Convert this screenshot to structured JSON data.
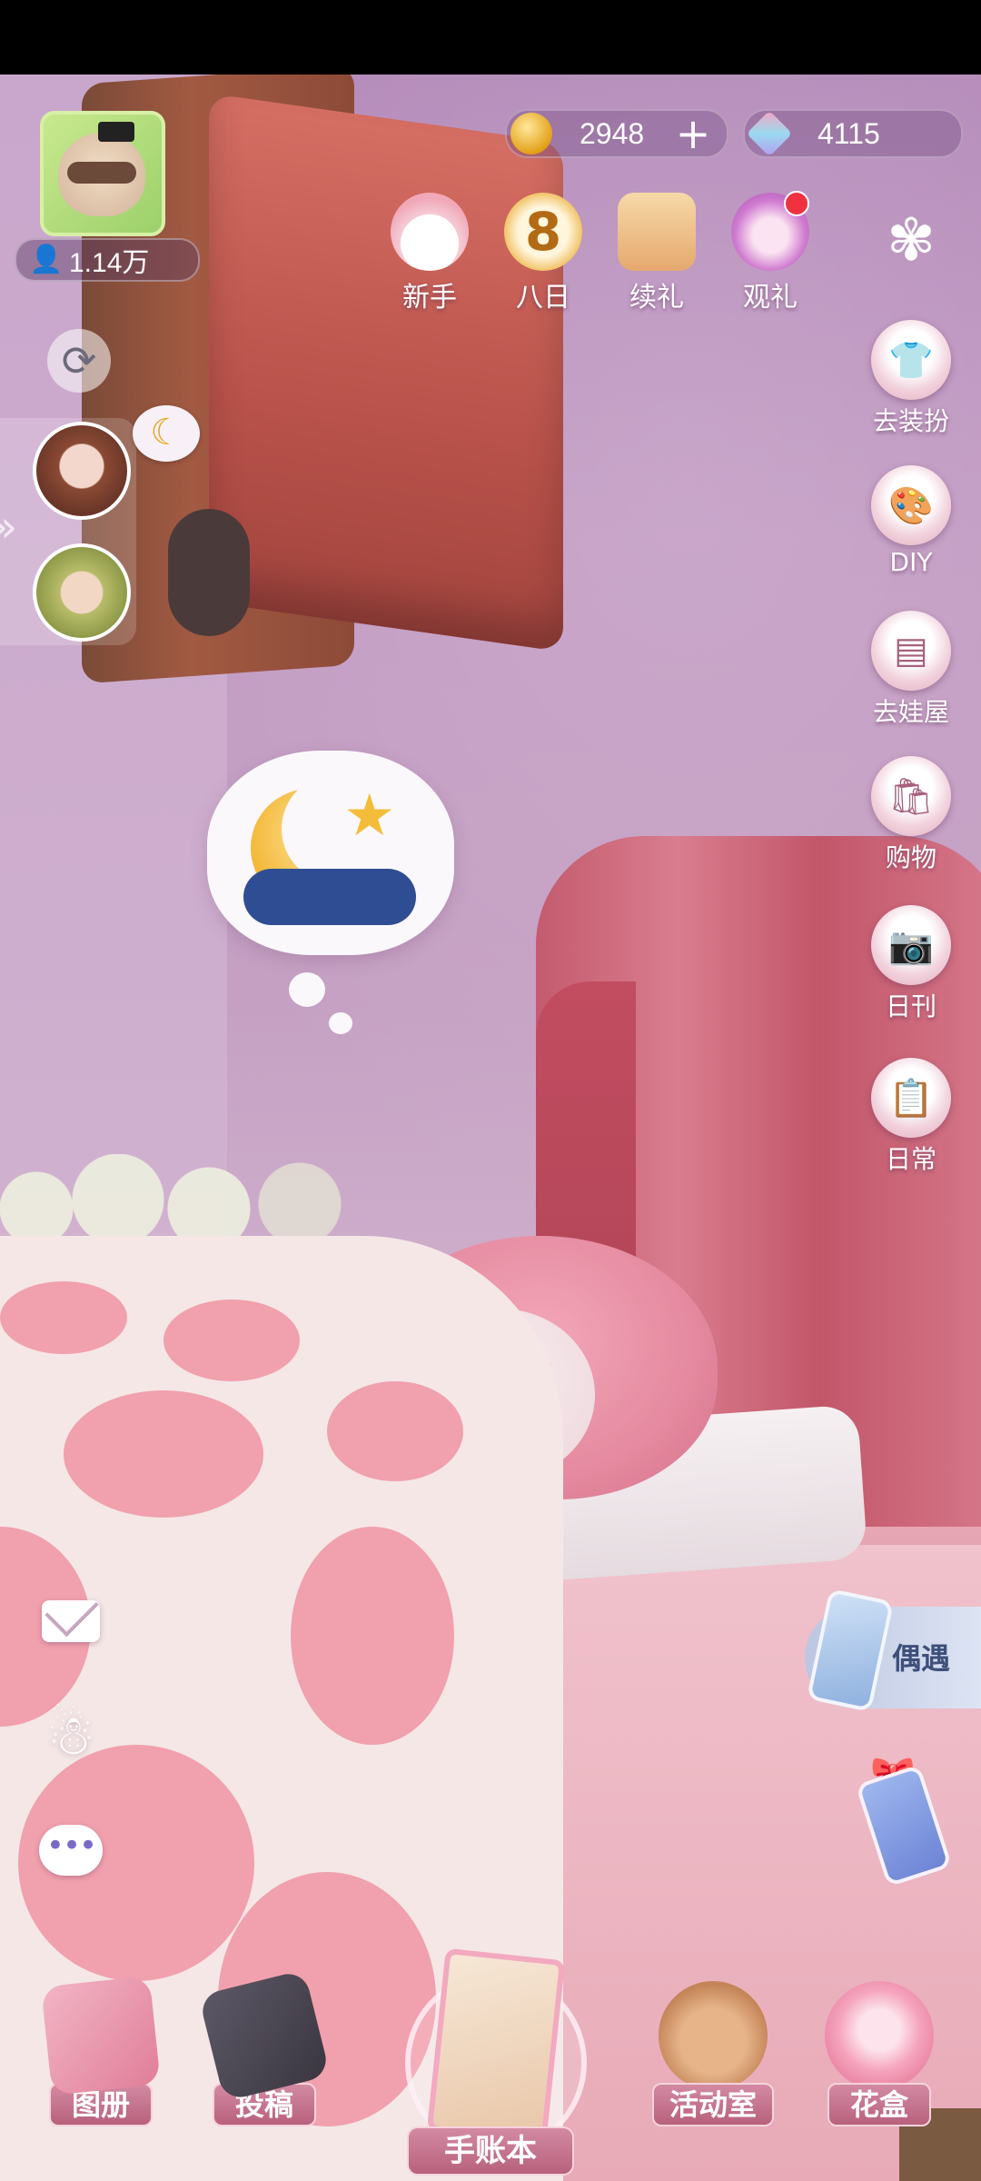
{
  "profile": {
    "followers": "1.14万"
  },
  "currency": {
    "gold": "2948",
    "gold_add": "+",
    "gems": "4115"
  },
  "top_icons": [
    {
      "label": "新手",
      "icon": "bunny-gift-icon"
    },
    {
      "label": "八日",
      "icon": "eight-day-icon",
      "badge": "8"
    },
    {
      "label": "续礼",
      "icon": "tv-gift-icon"
    },
    {
      "label": "观礼",
      "icon": "paw-gift-icon",
      "has_red_dot": true
    }
  ],
  "right_menu": [
    {
      "label": "去装扮",
      "icon": "shirt-icon",
      "glyph": "👕"
    },
    {
      "label": "DIY",
      "icon": "palette-icon",
      "glyph": "🎨"
    },
    {
      "label": "去娃屋",
      "icon": "cabinet-icon",
      "glyph": "▤"
    },
    {
      "label": "购物",
      "icon": "shopping-bag-icon",
      "glyph": "🛍"
    },
    {
      "label": "日刊",
      "icon": "camera-icon",
      "glyph": "📷"
    },
    {
      "label": "日常",
      "icon": "clipboard-icon",
      "glyph": "📋"
    }
  ],
  "encounter": {
    "label": "偶遇"
  },
  "bottom_nav": [
    {
      "label": "图册",
      "icon": "album-icon"
    },
    {
      "label": "投稿",
      "icon": "film-reel-icon"
    },
    {
      "label": "手账本",
      "icon": "scrapbook-icon"
    },
    {
      "label": "活动室",
      "icon": "teddy-bear-icon"
    },
    {
      "label": "花盒",
      "icon": "flower-box-icon"
    }
  ],
  "colors": {
    "accent": "#b8617d",
    "red_dot": "#f0313f",
    "wall": "#c29bc3"
  }
}
